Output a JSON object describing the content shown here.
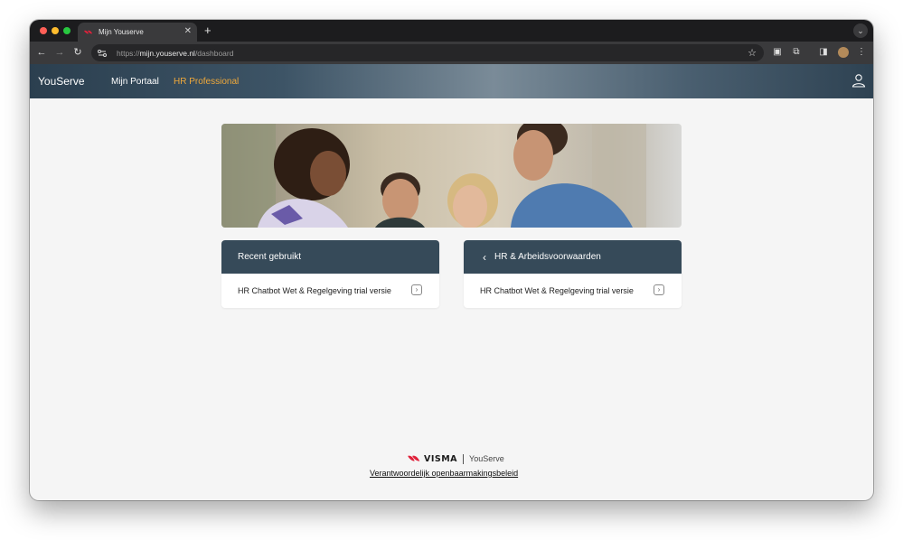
{
  "browser": {
    "tab_title": "Mijn Youserve",
    "new_tab": "+",
    "tab_close": "✕",
    "tab_menu": "⌄",
    "url_scheme": "https://",
    "url_host": "mijn.youserve.nl",
    "url_path": "/dashboard"
  },
  "header": {
    "brand": "YouServe",
    "nav": [
      {
        "label": "Mijn Portaal",
        "active": false
      },
      {
        "label": "HR Professional",
        "active": true
      }
    ],
    "accent_color": "#f0a93a"
  },
  "cards": [
    {
      "title": "Recent gebruikt",
      "back": false,
      "items": [
        {
          "label": "HR Chatbot Wet & Regelgeving trial versie"
        }
      ]
    },
    {
      "title": "HR & Arbeidsvoorwaarden",
      "back": true,
      "items": [
        {
          "label": "HR Chatbot Wet & Regelgeving trial versie"
        }
      ]
    }
  ],
  "footer": {
    "logo_brand": "VISMA",
    "logo_product": "YouServe",
    "link": "Verantwoordelijk openbaarmakingsbeleid"
  },
  "colors": {
    "card_header": "#364a59",
    "visma_red": "#e0213a"
  }
}
